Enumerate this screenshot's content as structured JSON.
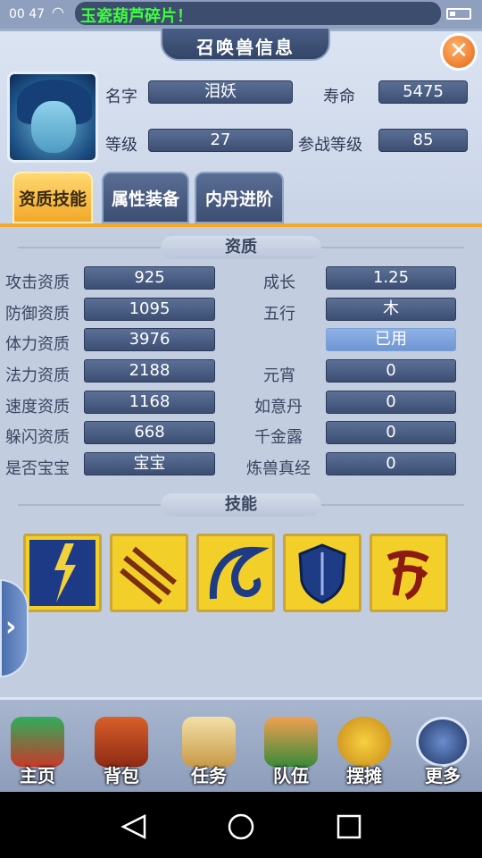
{
  "status_bar": {
    "time": "00 47",
    "marquee": "玉瓷葫芦碎片！"
  },
  "title": "召唤兽信息",
  "close_glyph": "✕",
  "pet": {
    "name_label": "名字",
    "name": "泪妖",
    "life_label": "寿命",
    "life": "5475",
    "level_label": "等级",
    "level": "27",
    "battle_level_label": "参战等级",
    "battle_level": "85"
  },
  "tabs": [
    {
      "label": "资质技能",
      "active": true
    },
    {
      "label": "属性装备",
      "active": false
    },
    {
      "label": "内丹进阶",
      "active": false
    }
  ],
  "aptitude_section": "资质",
  "aptitudes_left": [
    {
      "label": "攻击资质",
      "value": "925"
    },
    {
      "label": "防御资质",
      "value": "1095"
    },
    {
      "label": "体力资质",
      "value": "3976"
    },
    {
      "label": "法力资质",
      "value": "2188"
    },
    {
      "label": "速度资质",
      "value": "1168"
    },
    {
      "label": "躲闪资质",
      "value": "668"
    },
    {
      "label": "是否宝宝",
      "value": "宝宝"
    }
  ],
  "aptitudes_right": [
    {
      "label": "成长",
      "value": "1.25"
    },
    {
      "label": "五行",
      "value": "木"
    },
    {
      "label": "",
      "value": "已用"
    },
    {
      "label": "元宵",
      "value": "0"
    },
    {
      "label": "如意丹",
      "value": "0"
    },
    {
      "label": "千金露",
      "value": "0"
    },
    {
      "label": "炼兽真经",
      "value": "0"
    }
  ],
  "skills_section": "技能",
  "skills": [
    {
      "icon": "lightning-skill-icon"
    },
    {
      "icon": "claw-skill-icon"
    },
    {
      "icon": "wave-skill-icon"
    },
    {
      "icon": "shield-skill-icon"
    },
    {
      "icon": "rune-skill-icon"
    }
  ],
  "bottom_menu": [
    {
      "label": "主页",
      "icon": "home-icon"
    },
    {
      "label": "背包",
      "icon": "chest-icon"
    },
    {
      "label": "任务",
      "icon": "scroll-icon"
    },
    {
      "label": "队伍",
      "icon": "team-icon"
    },
    {
      "label": "摆摊",
      "icon": "coin-icon"
    },
    {
      "label": "更多",
      "icon": "more-icon"
    }
  ],
  "colors": {
    "accent": "#f2a82a",
    "field": "#4a5e86",
    "used": "#7fa6de"
  }
}
